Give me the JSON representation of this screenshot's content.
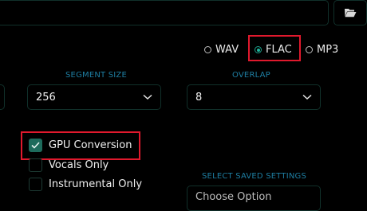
{
  "output_format": {
    "options": [
      {
        "label": "WAV",
        "selected": false
      },
      {
        "label": "FLAC",
        "selected": true
      },
      {
        "label": "MP3",
        "selected": false
      }
    ]
  },
  "segment_size": {
    "label": "SEGMENT SIZE",
    "value": "256"
  },
  "overlap": {
    "label": "OVERLAP",
    "value": "8"
  },
  "checkboxes": [
    {
      "label": "GPU Conversion",
      "checked": true
    },
    {
      "label": "Vocals Only",
      "checked": false
    },
    {
      "label": "Instrumental Only",
      "checked": false
    }
  ],
  "saved_settings": {
    "label": "SELECT SAVED SETTINGS",
    "value": "Choose Option"
  },
  "colors": {
    "accent": "#1fb59c",
    "label_blue": "#1e7ea2",
    "highlight_red": "#e0192d"
  }
}
